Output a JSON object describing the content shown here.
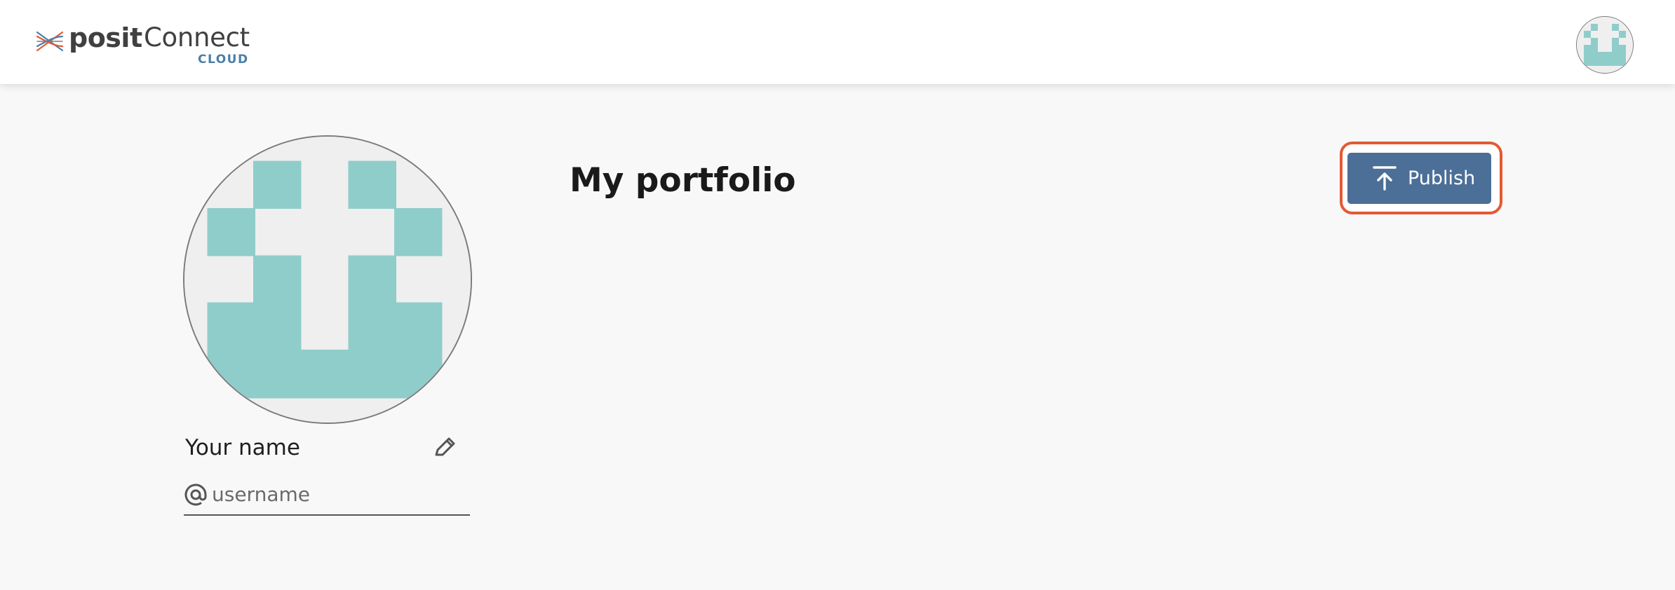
{
  "header": {
    "logo": {
      "brand": "posit",
      "trademark": "™",
      "product": "Connect",
      "tier": "CLOUD"
    },
    "avatar_icon": "identicon-avatar",
    "colors": {
      "logo_orange": "#e35a33",
      "logo_blue": "#4a7fa8",
      "logo_text": "#404040"
    }
  },
  "profile": {
    "avatar_icon": "identicon-avatar",
    "avatar_color": "#8fcdca",
    "display_name": "Your name",
    "edit_icon": "pencil-icon",
    "username_icon": "at-sign-icon",
    "username_placeholder": "username",
    "username_value": ""
  },
  "main": {
    "title": "My portfolio",
    "publish_button": {
      "label": "Publish",
      "icon": "upload-icon",
      "color": "#4c6f97",
      "focus_ring_color": "#e35a33"
    }
  }
}
